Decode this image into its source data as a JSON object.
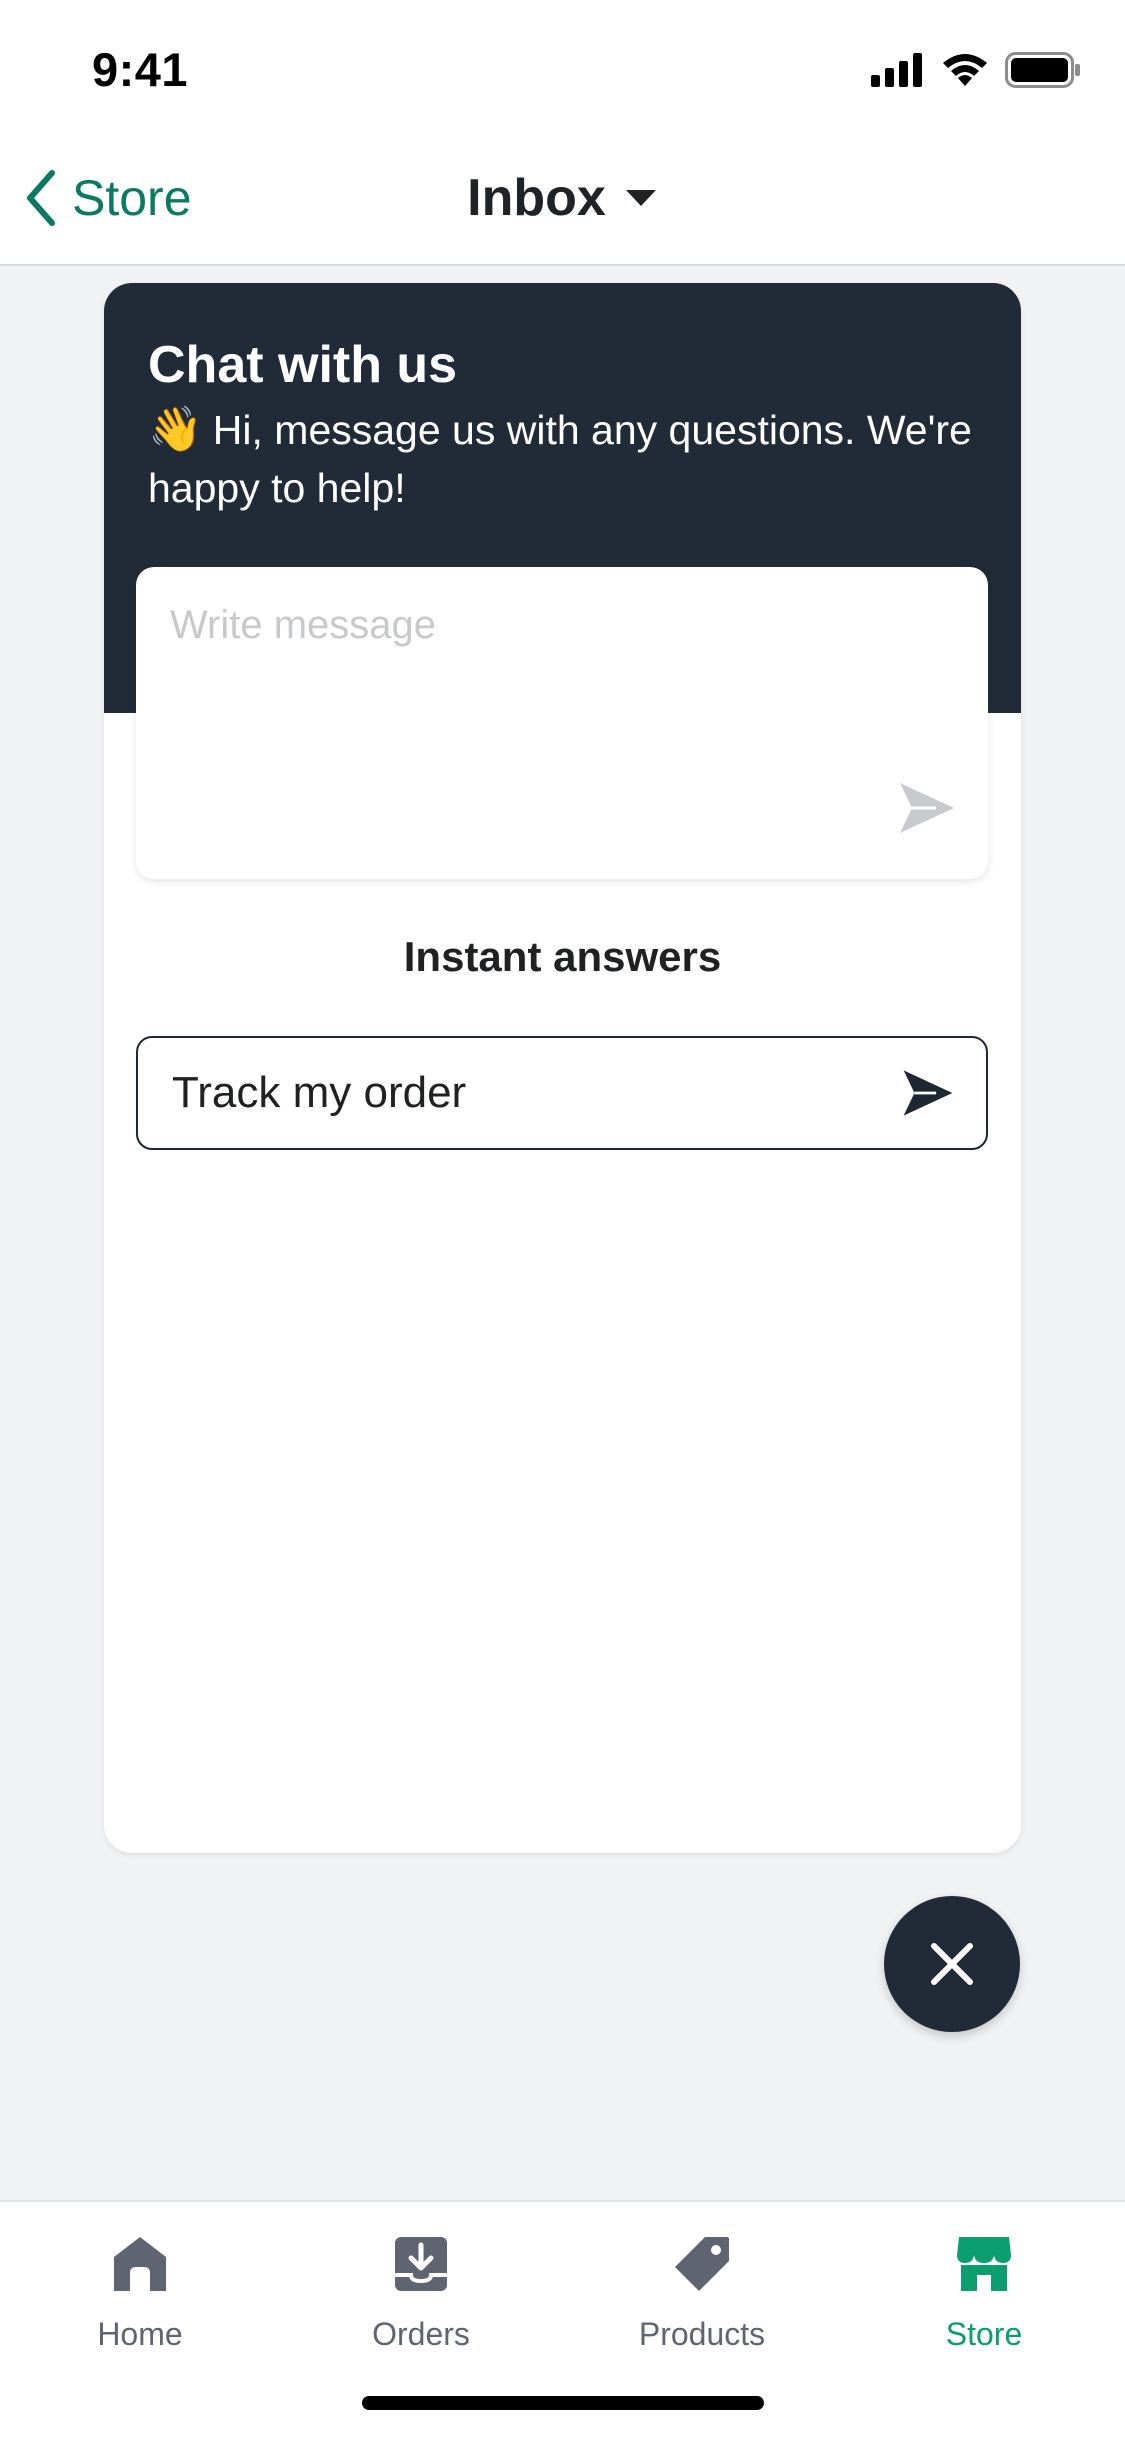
{
  "status_bar": {
    "time": "9:41"
  },
  "nav": {
    "back_label": "Store",
    "title": "Inbox"
  },
  "chat": {
    "title": "Chat with us",
    "greeting_emoji": "👋",
    "greeting_text": "Hi, message us with any questions. We're happy to help!",
    "message_placeholder": "Write message",
    "instant_answers_title": "Instant answers",
    "instant_answers": [
      "Track my order"
    ]
  },
  "tab_bar": {
    "items": [
      {
        "label": "Home",
        "icon": "home-icon",
        "active": false
      },
      {
        "label": "Orders",
        "icon": "orders-icon",
        "active": false
      },
      {
        "label": "Products",
        "icon": "tag-icon",
        "active": false
      },
      {
        "label": "Store",
        "icon": "store-icon",
        "active": true
      }
    ]
  },
  "colors": {
    "accent": "#0b7a62",
    "active_tab": "#0b9e6f",
    "chat_header": "#212a37",
    "background": "#f1f2f4"
  }
}
